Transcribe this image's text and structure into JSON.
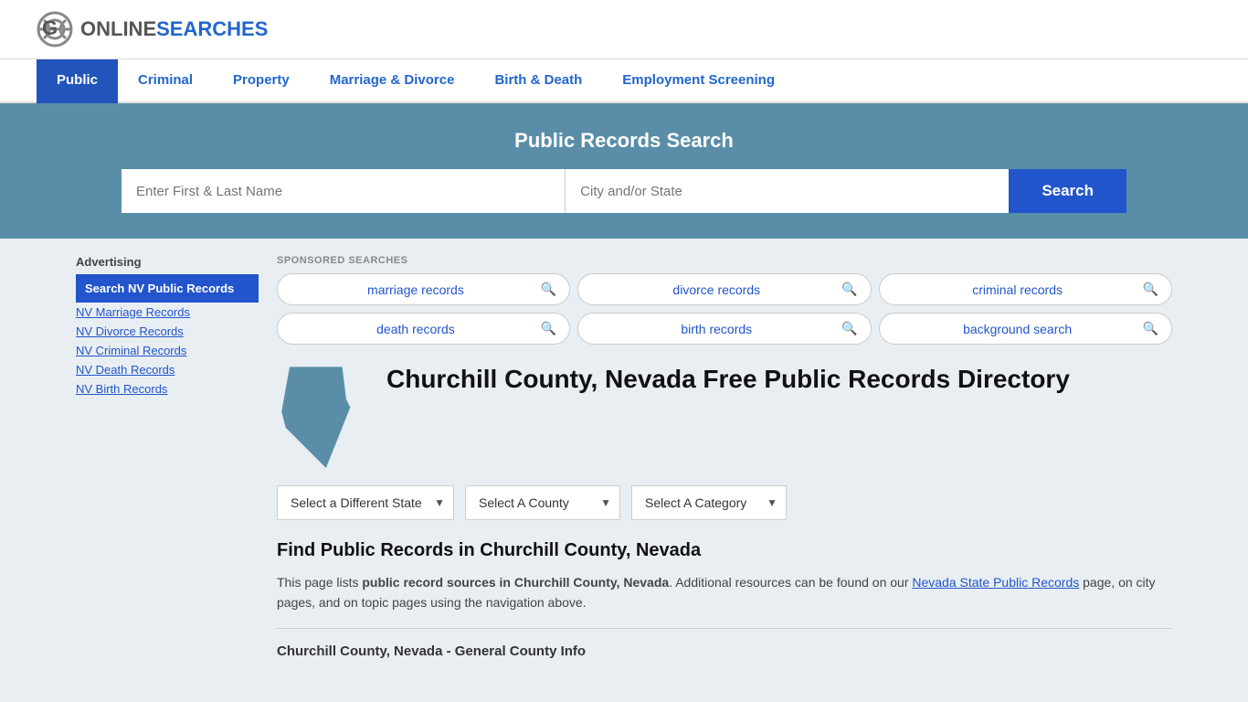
{
  "site": {
    "logo_online": "ONLINE",
    "logo_searches": "SEARCHES"
  },
  "nav": {
    "items": [
      {
        "label": "Public",
        "active": true
      },
      {
        "label": "Criminal",
        "active": false
      },
      {
        "label": "Property",
        "active": false
      },
      {
        "label": "Marriage & Divorce",
        "active": false
      },
      {
        "label": "Birth & Death",
        "active": false
      },
      {
        "label": "Employment Screening",
        "active": false
      }
    ]
  },
  "hero": {
    "title": "Public Records Search",
    "name_placeholder": "Enter First & Last Name",
    "location_placeholder": "City and/or State",
    "search_label": "Search"
  },
  "sponsored": {
    "label": "SPONSORED SEARCHES",
    "items": [
      {
        "text": "marriage records"
      },
      {
        "text": "divorce records"
      },
      {
        "text": "criminal records"
      },
      {
        "text": "death records"
      },
      {
        "text": "birth records"
      },
      {
        "text": "background search"
      }
    ]
  },
  "main": {
    "page_title": "Churchill County, Nevada Free Public Records Directory",
    "dropdowns": {
      "state_label": "Select a Different State",
      "county_label": "Select A County",
      "category_label": "Select A Category"
    },
    "find_title": "Find Public Records in Churchill County, Nevada",
    "find_desc_1": "This page lists ",
    "find_desc_bold": "public record sources in Churchill County, Nevada",
    "find_desc_2": ". Additional resources can be found on our ",
    "find_link_text": "Nevada State Public Records",
    "find_desc_3": " page, on city pages, and on topic pages using the navigation above.",
    "general_info": "Churchill County, Nevada - General County Info"
  },
  "sidebar": {
    "ad_label": "Advertising",
    "ad_active": "Search NV Public Records",
    "links": [
      "NV Marriage Records",
      "NV Divorce Records",
      "NV Criminal Records",
      "NV Death Records",
      "NV Birth Records"
    ]
  }
}
